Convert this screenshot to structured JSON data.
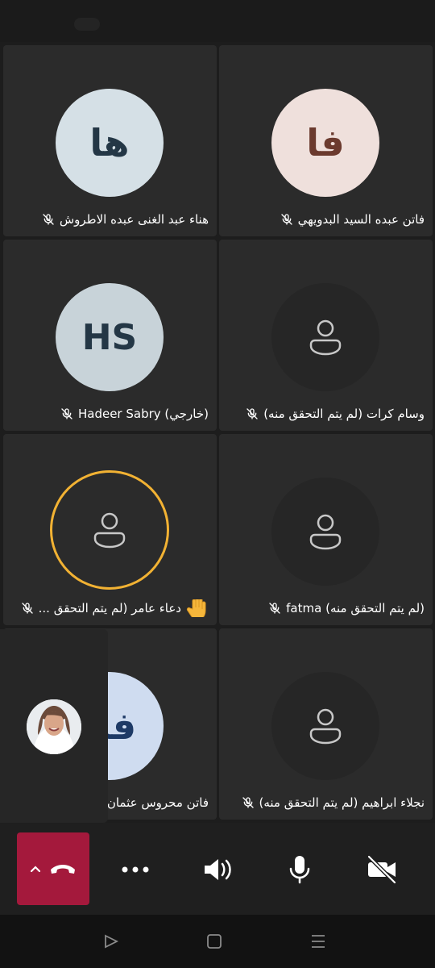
{
  "participants": [
    {
      "name": "فاتن عبده السيد البدويهي",
      "initials": "فا",
      "avatar_bg": "#efe0dc",
      "initials_color": "#6b3a2e",
      "muted": true
    },
    {
      "name": "هناء عبد الغنى عبده الاطروش",
      "initials": "ها",
      "avatar_bg": "#d5e0e6",
      "initials_color": "#243746",
      "muted": true
    },
    {
      "name": "وسام كرات  (لم يتم التحقق منه)",
      "initials": "",
      "avatar_bg": "#262626",
      "muted": true
    },
    {
      "name": "Hadeer Sabry (خارجي)",
      "initials": "HS",
      "avatar_bg": "#c8d3d9",
      "initials_color": "#243746",
      "muted": true
    },
    {
      "name": "(لم يتم التحقق منه) fatma",
      "initials": "",
      "avatar_bg": "#262626",
      "muted": true
    },
    {
      "name": "دعاء عامر (لم يتم التحقق ...",
      "initials": "",
      "avatar_bg": "#2b2b2b",
      "muted": true,
      "hand_raised": true,
      "speaking": true
    },
    {
      "name": "نجلاء ابراهيم (لم يتم التحقق منه)",
      "initials": "",
      "avatar_bg": "#262626",
      "muted": true
    },
    {
      "name": "فاتن محروس عثمان",
      "initials": "فم",
      "avatar_bg": "#cfdcf0",
      "initials_color": "#1e3a66",
      "muted": false
    }
  ],
  "icons": {
    "mic_off": "microphone-off-icon",
    "person": "person-placeholder-icon",
    "hand": "raised-hand-icon",
    "hangup": "phone-hangup-icon",
    "more": "more-options-icon",
    "speaker": "speaker-icon",
    "mic": "microphone-icon",
    "camera_off": "camera-off-icon"
  },
  "colors": {
    "hangup_bg": "#a4193c",
    "speaking_ring": "#f2b233",
    "tile_bg": "#2b2b2b"
  }
}
